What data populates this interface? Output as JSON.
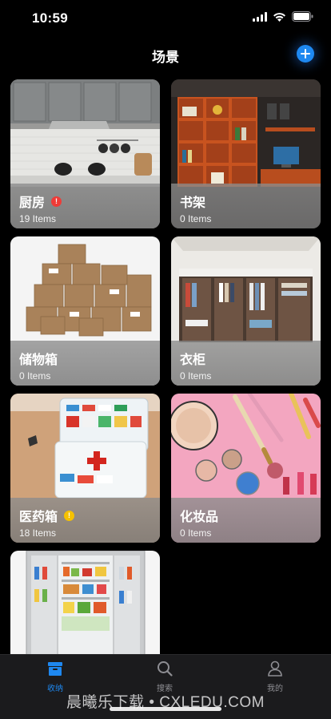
{
  "status_bar": {
    "time": "10:59"
  },
  "nav": {
    "title": "场景"
  },
  "scenes": [
    {
      "name": "厨房",
      "count": "19 Items",
      "badge": "!",
      "badge_color": "red"
    },
    {
      "name": "书架",
      "count": "0 Items"
    },
    {
      "name": "储物箱",
      "count": "0 Items"
    },
    {
      "name": "衣柜",
      "count": "0 Items"
    },
    {
      "name": "医药箱",
      "count": "18 Items",
      "badge": "!",
      "badge_color": "yellow"
    },
    {
      "name": "化妆品",
      "count": "0 Items"
    },
    {
      "name": "",
      "count": ""
    }
  ],
  "tabs": [
    {
      "label": "收纳",
      "icon": "box-icon",
      "active": true
    },
    {
      "label": "搜索",
      "icon": "search-icon"
    },
    {
      "label": "我的",
      "icon": "person-icon"
    }
  ],
  "watermark": "晨曦乐下载 • CXLEDU.COM",
  "colors": {
    "accent": "#1e88f0",
    "badge_red": "#ef3b37",
    "badge_yellow": "#f5c100"
  }
}
